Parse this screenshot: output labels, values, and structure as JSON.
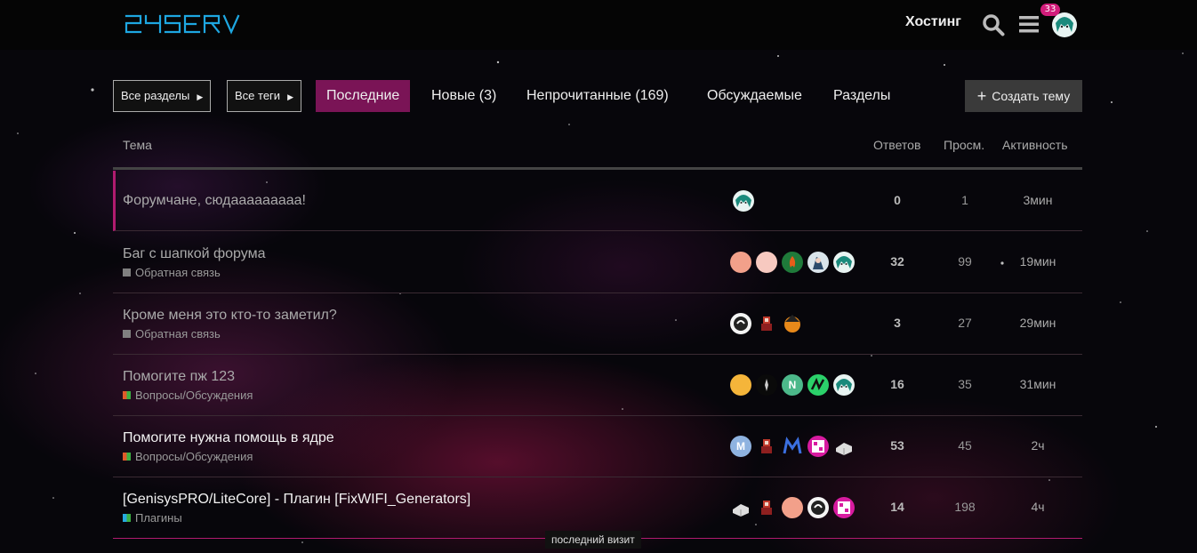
{
  "brand": {
    "logo_text": "24SERV",
    "logo_color": "#1ea7e1"
  },
  "header": {
    "link_label": "Хостинг",
    "notification_count": "33"
  },
  "filters": {
    "categories_label": "Все разделы",
    "tags_label": "Все теги"
  },
  "tabs": [
    {
      "label": "Последние",
      "active": true
    },
    {
      "label": "Новые (3)"
    },
    {
      "label": "Непрочитанные (169)"
    },
    {
      "label": "Обсуждаемые"
    },
    {
      "label": "Разделы"
    }
  ],
  "create_topic_label": "Создать тему",
  "columns": {
    "topic": "Тема",
    "replies": "Ответов",
    "views": "Просм.",
    "activity": "Активность"
  },
  "topics": [
    {
      "title": "Форумчане, сюдааааааааа!",
      "category": "",
      "replies": "0",
      "views": "1",
      "activity": "3мин",
      "unread": false,
      "pinned": true
    },
    {
      "title": "Баг с шапкой форума",
      "category": "Обратная связь",
      "replies": "32",
      "views": "99",
      "activity": "19мин",
      "unread": false
    },
    {
      "title": "Кроме меня это кто-то заметил?",
      "category": "Обратная связь",
      "replies": "3",
      "views": "27",
      "activity": "29мин",
      "unread": false
    },
    {
      "title": "Помогите пж 123",
      "category": "Вопросы/Обсуждения",
      "replies": "16",
      "views": "35",
      "activity": "31мин",
      "unread": false
    },
    {
      "title": "Помогите нужна помощь в ядре",
      "category": "Вопросы/Обсуждения",
      "replies": "53",
      "views": "45",
      "activity": "2ч",
      "unread": true
    },
    {
      "title": "[GenisysPRO/LiteCore] - Плагин [FixWIFI_Generators]",
      "category": "Плагины",
      "replies": "14",
      "views": "198",
      "activity": "4ч",
      "unread": true
    }
  ],
  "avatar_letters": {
    "n": "N",
    "m": "M"
  },
  "last_visit_label": "последний визит",
  "colors": {
    "accent": "#7a1456",
    "pinned_border": "#b01b6f",
    "badge": "#d21d7b",
    "feedback_category": "#808080",
    "questions_category_a": "#e05a2a",
    "questions_category_b": "#3cb043",
    "plugins_category_a": "#25a9e0",
    "plugins_category_b": "#3cb043"
  }
}
